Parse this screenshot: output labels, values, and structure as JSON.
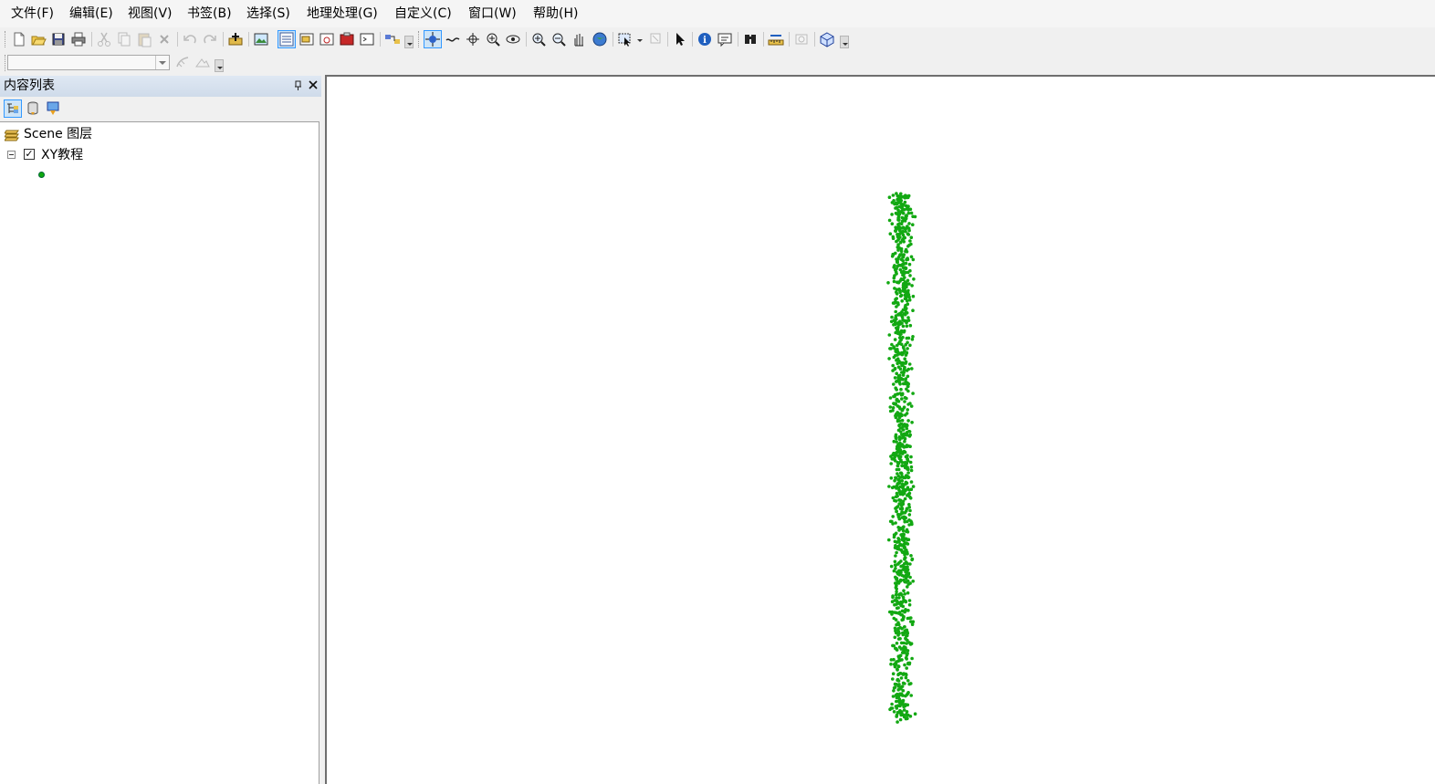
{
  "menubar": {
    "items": [
      {
        "label": "文件(F)"
      },
      {
        "label": "编辑(E)"
      },
      {
        "label": "视图(V)"
      },
      {
        "label": "书签(B)"
      },
      {
        "label": "选择(S)"
      },
      {
        "label": "地理处理(G)"
      },
      {
        "label": "自定义(C)"
      },
      {
        "label": "窗口(W)"
      },
      {
        "label": "帮助(H)"
      }
    ]
  },
  "toolbar": {
    "icons": [
      "new-document-icon",
      "open-folder-icon",
      "save-icon",
      "print-icon",
      "cut-icon",
      "copy-icon",
      "paste-icon",
      "delete-icon",
      "undo-icon",
      "redo-icon",
      "add-data-icon",
      "open-arcmap-icon",
      "table-of-contents-icon",
      "catalog-window-icon",
      "search-window-icon",
      "arctoolbox-icon",
      "python-window-icon",
      "model-builder-icon",
      "navigate-icon",
      "fly-icon",
      "target-center-icon",
      "zoom-to-target-icon",
      "set-observer-icon",
      "zoom-in-icon",
      "zoom-out-icon",
      "pan-icon",
      "full-extent-icon",
      "select-features-icon",
      "clear-selection-icon",
      "select-elements-icon",
      "identify-icon",
      "html-popup-icon",
      "find-icon",
      "measure-icon",
      "animation-icon",
      "3d-effects-icon"
    ]
  },
  "toc": {
    "title": "内容列表",
    "root_label": "Scene 图层",
    "layer_label": "XY教程",
    "layer_checked": true,
    "symbol_color": "#0fa90f"
  },
  "scene": {
    "background": "#ffffff",
    "point_color": "#12a812"
  }
}
